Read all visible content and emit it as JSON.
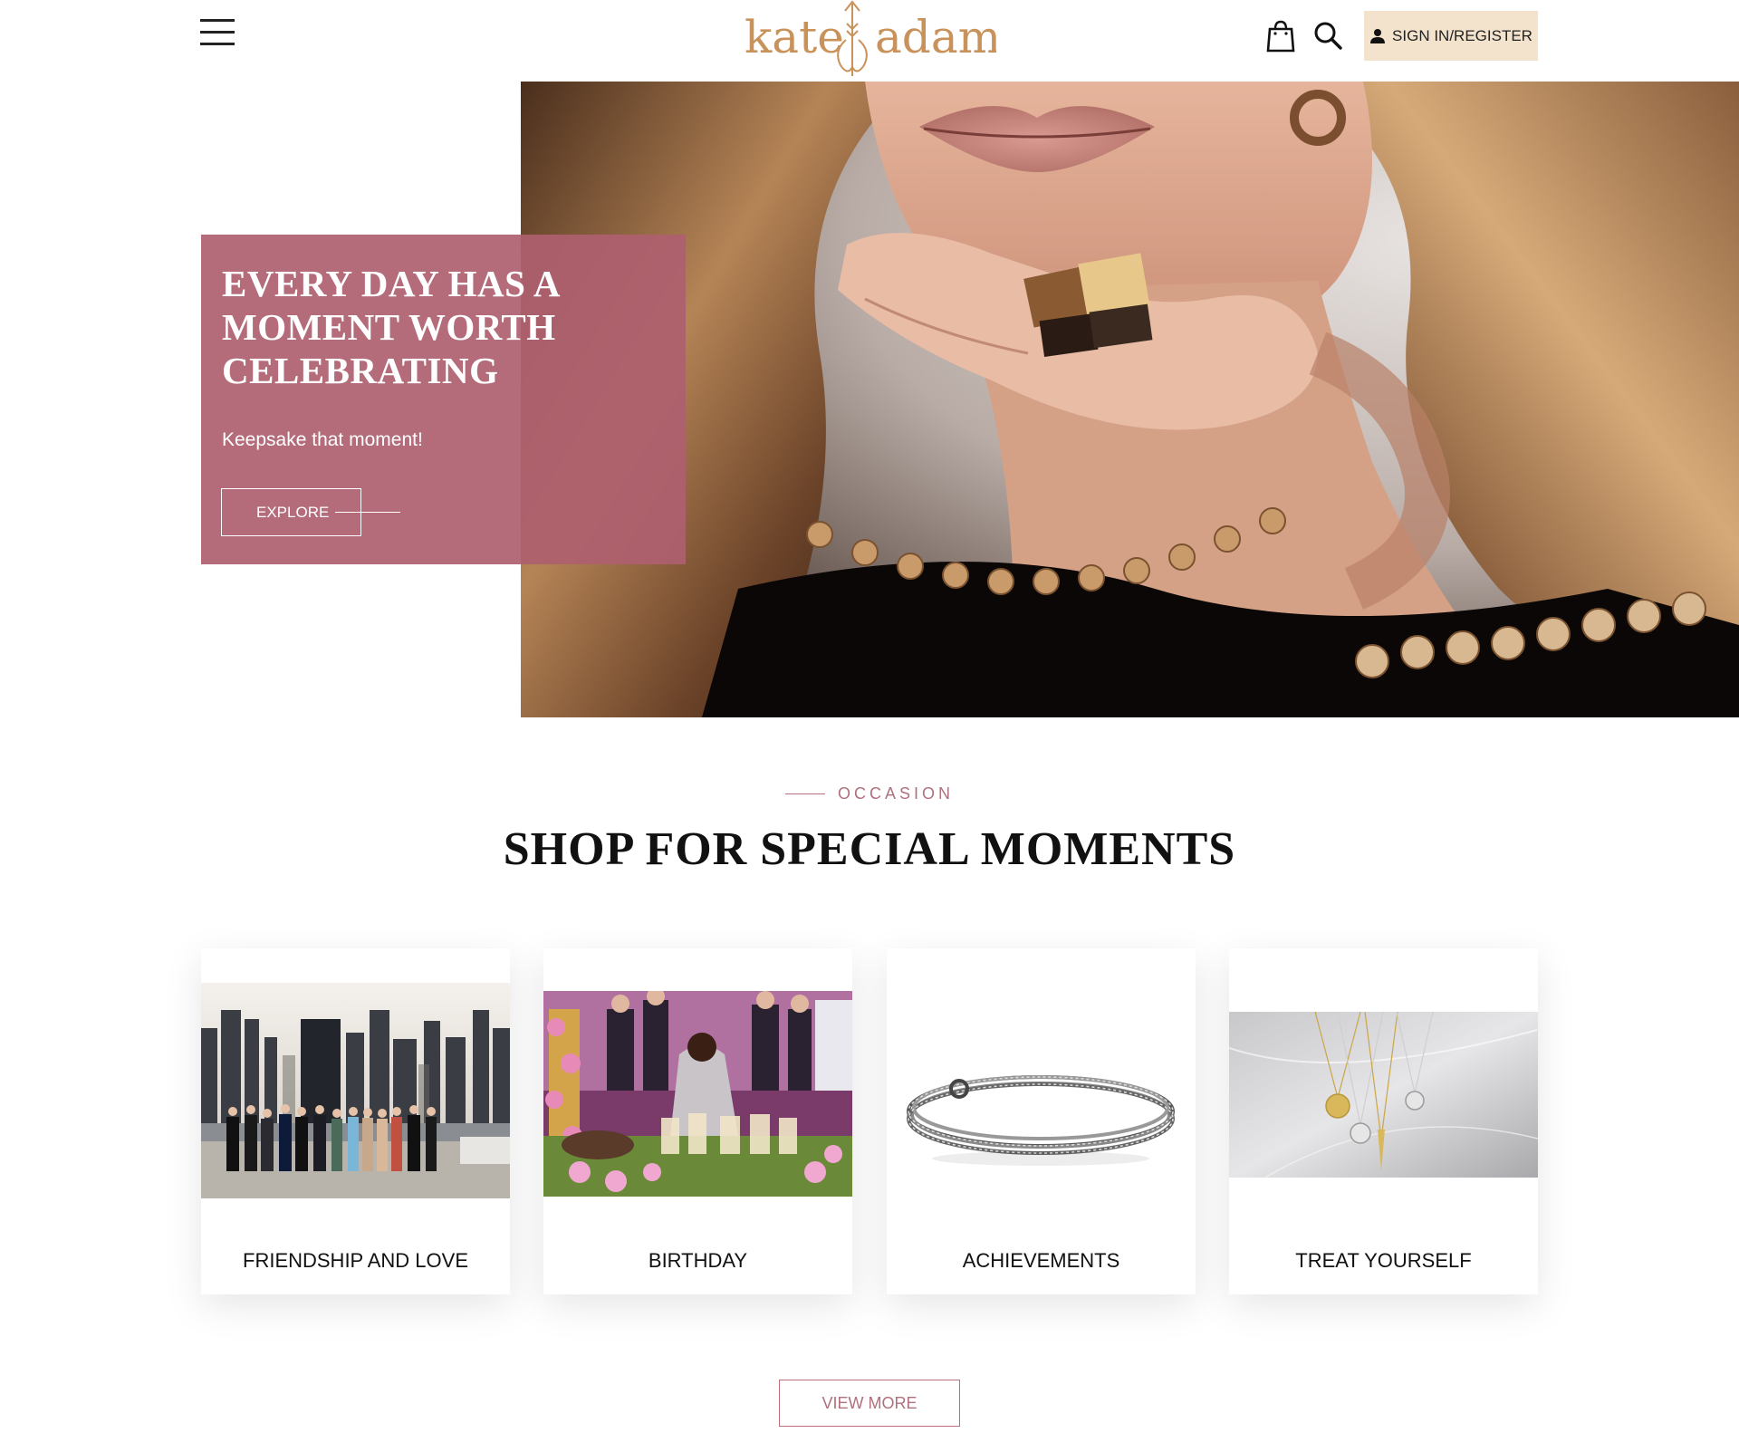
{
  "header": {
    "logo_left": "kate",
    "logo_right": "adam",
    "signin_label": "SIGN IN/REGISTER",
    "icons": [
      "menu-icon",
      "shopping-bag-icon",
      "search-icon",
      "user-icon"
    ]
  },
  "hero": {
    "title": "EVERY DAY HAS A MOMENT WORTH CELEBRATING",
    "subtitle": "Keepsake that moment!",
    "button_label": "EXPLORE"
  },
  "occasion": {
    "eyebrow": "OCCASION",
    "title": "SHOP FOR SPECIAL MOMENTS",
    "cards": [
      {
        "label": "FRIENDSHIP AND LOVE"
      },
      {
        "label": "BIRTHDAY"
      },
      {
        "label": "ACHIEVEMENTS"
      },
      {
        "label": "TREAT YOURSELF"
      }
    ],
    "view_more_label": "VIEW MORE"
  },
  "colors": {
    "brand_gold": "#c9925a",
    "panel_rose": "#ae5f6f",
    "accent_rose": "#b0707d",
    "signin_bg": "#f4e3cc"
  }
}
